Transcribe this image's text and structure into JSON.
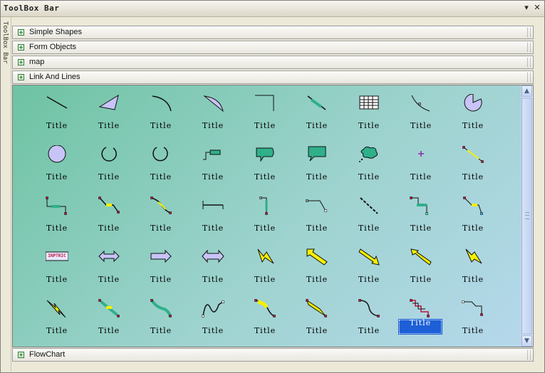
{
  "window": {
    "title": "ToolBox Bar",
    "pin_glyph": "▾",
    "close_glyph": "✕",
    "side_tab": "ToolBox Bar"
  },
  "categories": [
    {
      "label": "Simple Shapes"
    },
    {
      "label": "Form Objects"
    },
    {
      "label": "map"
    },
    {
      "label": "Link And Lines"
    }
  ],
  "footer_category": {
    "label": "FlowChart"
  },
  "items": [
    {
      "caption": "Title",
      "icon": "line-icon"
    },
    {
      "caption": "Title",
      "icon": "polygon-icon"
    },
    {
      "caption": "Title",
      "icon": "arc-icon"
    },
    {
      "caption": "Title",
      "icon": "chord-icon"
    },
    {
      "caption": "Title",
      "icon": "bracket-icon"
    },
    {
      "caption": "Title",
      "icon": "dimension-line-icon"
    },
    {
      "caption": "Title",
      "icon": "grid-table-icon"
    },
    {
      "caption": "Title",
      "icon": "curve-line-icon"
    },
    {
      "caption": "Title",
      "icon": "pie-icon"
    },
    {
      "caption": "Title",
      "icon": "circle-icon"
    },
    {
      "caption": "Title",
      "icon": "open-circle-icon"
    },
    {
      "caption": "Title",
      "icon": "circle-arc-icon"
    },
    {
      "caption": "Title",
      "icon": "label-connector-icon"
    },
    {
      "caption": "Title",
      "icon": "callout-round-icon"
    },
    {
      "caption": "Title",
      "icon": "callout-rect-icon"
    },
    {
      "caption": "Title",
      "icon": "cloud-callout-icon"
    },
    {
      "caption": "Title",
      "icon": "point-icon"
    },
    {
      "caption": "Title",
      "icon": "straight-link-icon"
    },
    {
      "caption": "Title",
      "icon": "elbow-link-icon"
    },
    {
      "caption": "Title",
      "icon": "diagonal-link-icon"
    },
    {
      "caption": "Title",
      "icon": "curved-link-icon"
    },
    {
      "caption": "Title",
      "icon": "flat-link-icon"
    },
    {
      "caption": "Title",
      "icon": "vertical-link-icon"
    },
    {
      "caption": "Title",
      "icon": "step-link-icon"
    },
    {
      "caption": "Title",
      "icon": "dashed-link-icon"
    },
    {
      "caption": "Title",
      "icon": "labeled-step-link-icon"
    },
    {
      "caption": "Title",
      "icon": "angled-link-icon"
    },
    {
      "caption": "Title",
      "icon": "text-tag-icon",
      "tag": "INPTRIC"
    },
    {
      "caption": "Title",
      "icon": "double-arrow-icon"
    },
    {
      "caption": "Title",
      "icon": "right-arrow-icon"
    },
    {
      "caption": "Title",
      "icon": "left-right-arrow-icon"
    },
    {
      "caption": "Title",
      "icon": "bolt-icon"
    },
    {
      "caption": "Title",
      "icon": "yellow-arrow-up-icon"
    },
    {
      "caption": "Title",
      "icon": "yellow-arrow-down-icon"
    },
    {
      "caption": "Title",
      "icon": "yellow-bolt-arrow-icon"
    },
    {
      "caption": "Title",
      "icon": "bolt-line-icon"
    },
    {
      "caption": "Title",
      "icon": "lightning-icon"
    },
    {
      "caption": "Title",
      "icon": "green-bar-link-icon"
    },
    {
      "caption": "Title",
      "icon": "green-bar-curve-icon"
    },
    {
      "caption": "Title",
      "icon": "wave-line-icon"
    },
    {
      "caption": "Title",
      "icon": "yellow-curve-link-icon"
    },
    {
      "caption": "Title",
      "icon": "yellow-wedge-link-icon"
    },
    {
      "caption": "Title",
      "icon": "s-curve-link-icon"
    },
    {
      "caption": "Title",
      "icon": "multi-step-link-icon",
      "selected": true
    },
    {
      "caption": "Title",
      "icon": "hook-link-icon"
    }
  ],
  "colors": {
    "accent": "#1c5fd6",
    "panel_start": "#6ec3a3",
    "panel_end": "#b6d8ec",
    "shape_fill": "#c8c4f8",
    "highlight_yellow": "#f4f000",
    "endpoint_red": "#c0143c"
  }
}
